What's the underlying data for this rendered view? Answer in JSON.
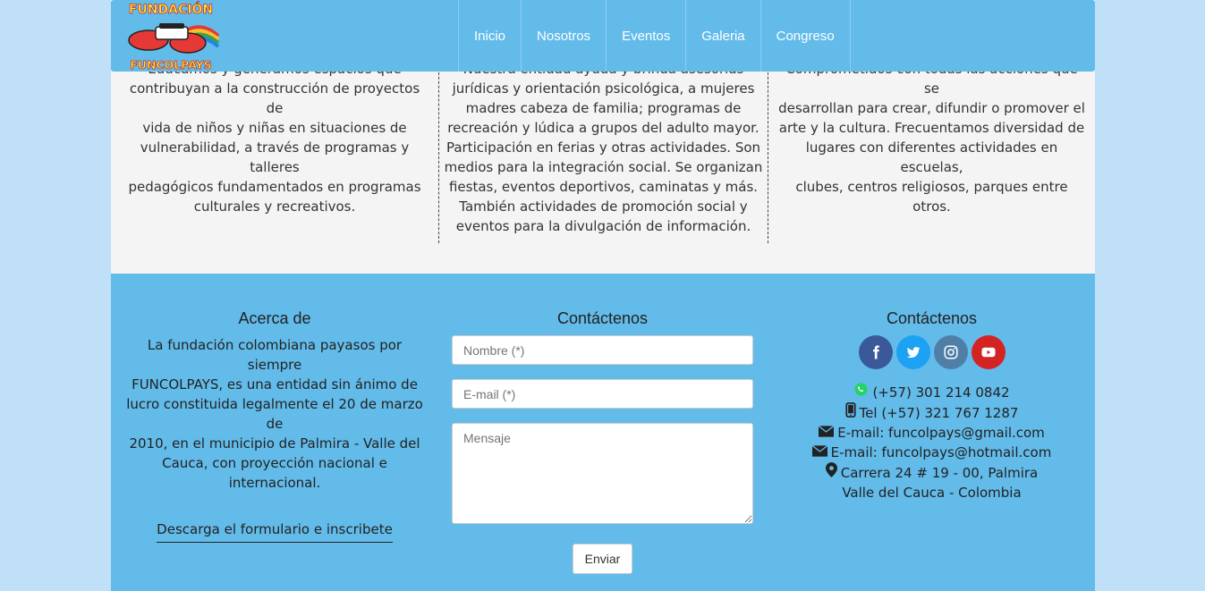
{
  "nav": {
    "logo_top": "FUNDACIÓN",
    "logo_bottom": "FUNCOLPAYS",
    "items": [
      "Inicio",
      "Nosotros",
      "Eventos",
      "Galeria",
      "Congreso"
    ]
  },
  "services": {
    "col1": [
      "Educamos y generamos espacios que",
      "contribuyan a la construcción de proyectos de",
      "vida de niños y niñas en situaciones de",
      "vulnerabilidad, a través de programas y talleres",
      "pedagógicos fundamentados en programas",
      "culturales y recreativos."
    ],
    "col2": [
      "Nuestra entidad ayuda y brinda asesorías",
      "jurídicas y orientación psicológica, a mujeres",
      "madres cabeza de familia; programas de",
      "recreación y lúdica a grupos del adulto mayor.",
      "Participación en ferias y otras actividades. Son",
      "medios para la integración social. Se organizan",
      "fiestas, eventos deportivos, caminatas y más.",
      "También actividades de promoción social y",
      "eventos para la divulgación de información."
    ],
    "col3": [
      "Comprometidos con todas las acciones que se",
      "desarrollan para crear, difundir o promover el",
      "arte y la cultura. Frecuentamos diversidad de",
      "lugares con diferentes actividades en escuelas,",
      "clubes, centros religiosos, parques entre otros."
    ]
  },
  "footer": {
    "about": {
      "title": "Acerca de",
      "lines": [
        "La fundación colombiana payasos por siempre",
        "FUNCOLPAYS, es una entidad sin ánimo de",
        "lucro constituida legalmente el 20 de marzo de",
        "2010, en el municipio de Palmira - Valle del",
        "Cauca, con proyección nacional e",
        "internacional."
      ],
      "download_link": "Descarga el formulario e inscribete"
    },
    "contact_form": {
      "title": "Contáctenos",
      "name_placeholder": "Nombre (*)",
      "email_placeholder": "E-mail (*)",
      "message_placeholder": "Mensaje",
      "send_label": "Enviar"
    },
    "contact_info": {
      "title": "Contáctenos",
      "social": [
        "facebook-icon",
        "twitter-icon",
        "instagram-icon",
        "youtube-icon"
      ],
      "whatsapp": "(+57) 301 214 0842",
      "phone": "Tel (+57) 321 767 1287",
      "email1": "E-mail: funcolpays@gmail.com",
      "email2": "E-mail: funcolpays@hotmail.com",
      "address": "Carrera 24 # 19 - 00, Palmira",
      "city": "Valle del Cauca - Colombia"
    }
  },
  "colors": {
    "nav_bg": "#63bbea",
    "footer_bg": "#63bbea",
    "page_bg": "#f4f4f4",
    "outer_bg": "#bfe0f7"
  }
}
